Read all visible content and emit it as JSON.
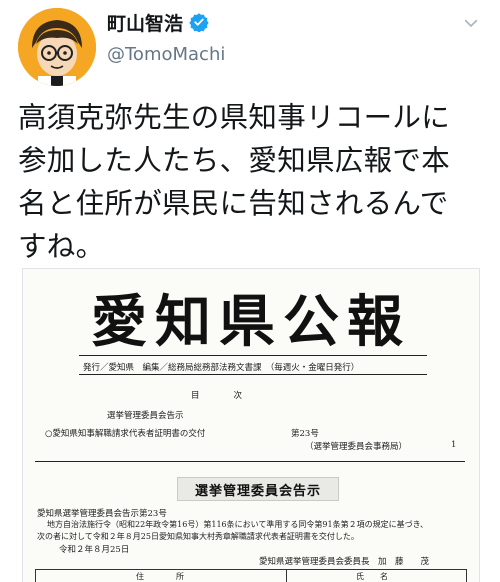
{
  "user": {
    "display_name": "町山智浩",
    "handle": "@TomoMachi",
    "verified": true
  },
  "tweet": {
    "text": "高須克弥先生の県知事リコールに\n参加した人たち、愛知県広報で本\n名と住所が県民に告知されるんで\nすね。"
  },
  "document": {
    "title": "愛知県公報",
    "publisher_line": "発行／愛知県　編集／総務局総務部法務文書課　（毎週火・金曜日発行）",
    "toc_label": "目　　　　次",
    "toc_section": "選挙管理委員会告示",
    "toc_item": "○愛知県知事解職請求代表者証明書の交付",
    "toc_number": "第23号",
    "toc_issuer": "（選挙管理委員会事務局）",
    "toc_page": "1",
    "banner": "選挙管理委員会告示",
    "notice_no": "愛知県選挙管理委員会告示第23号",
    "body_line1": "地方自治法施行令（昭和22年政令第16号）第116条において準用する同令第91条第２項の規定に基づき、",
    "body_line2": "次の者に対して令和２年８月25日愛知県知事大村秀章解職請求代表者証明書を交付した。",
    "date": "令和２年８月25日",
    "signatory": "愛知県選挙管理委員会委員長　加　藤　　茂",
    "table_col1": "住　　　　所",
    "table_col2": "氏　　名"
  },
  "colors": {
    "verified": "#1da1f2",
    "handle": "#657786",
    "avatar_bg": "#f5a623"
  }
}
